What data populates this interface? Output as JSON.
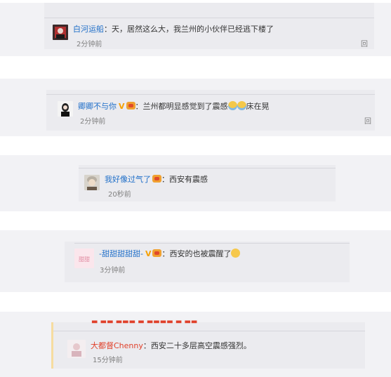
{
  "comments": [
    {
      "name": "白河运船",
      "text": "：天，居然这么大，我兰州的小伙伴已经逃下楼了",
      "time": "2分钟前",
      "reply": "回复"
    },
    {
      "name": "卿卿不与你",
      "text_before": "：兰州都明显感觉到了震感",
      "text_after": "床在晃",
      "time": "2分钟前",
      "reply": "回"
    },
    {
      "name": "我好像过气了",
      "text": "：西安有震感",
      "time": "20秒前"
    },
    {
      "name": "-甜甜甜甜甜-",
      "text": "：西安的也被震醒了",
      "time": "3分钟前"
    },
    {
      "name": "大都督Chenny",
      "text": "：西安二十多层高空震感强烈。",
      "time": "15分钟前"
    }
  ],
  "avatar_texts": {
    "pink_card": "甜甜"
  },
  "colors": {
    "name_link": "#1e6ec8",
    "time": "#808080",
    "vip_badge": "#f5a000",
    "band": "#f2f2f5",
    "card": "#ebebef"
  },
  "icons": {
    "vip": "vip-v-icon",
    "medal": "medal-icon",
    "cry": "cry-emoji-icon",
    "sweat": "sweat-emoji-icon"
  }
}
